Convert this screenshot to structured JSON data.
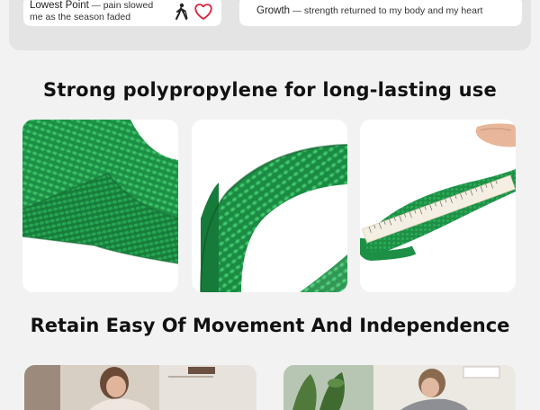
{
  "cards": {
    "left": {
      "title": "Lowest Point",
      "separator": "—",
      "text": "pain slowed me as the season faded"
    },
    "right": {
      "title": "Growth",
      "separator": "—",
      "text": "strength returned to my body and my heart"
    }
  },
  "icons": [
    "walking-person-icon",
    "heart-icon"
  ],
  "headings": {
    "material": "Strong polypropylene for long-lasting use",
    "movement": "Retain Easy Of Movement And Independence"
  },
  "colors": {
    "strap_green": "#1f9a4a",
    "background": "#f2f2f2",
    "card": "#ffffff",
    "heading": "#111111"
  }
}
